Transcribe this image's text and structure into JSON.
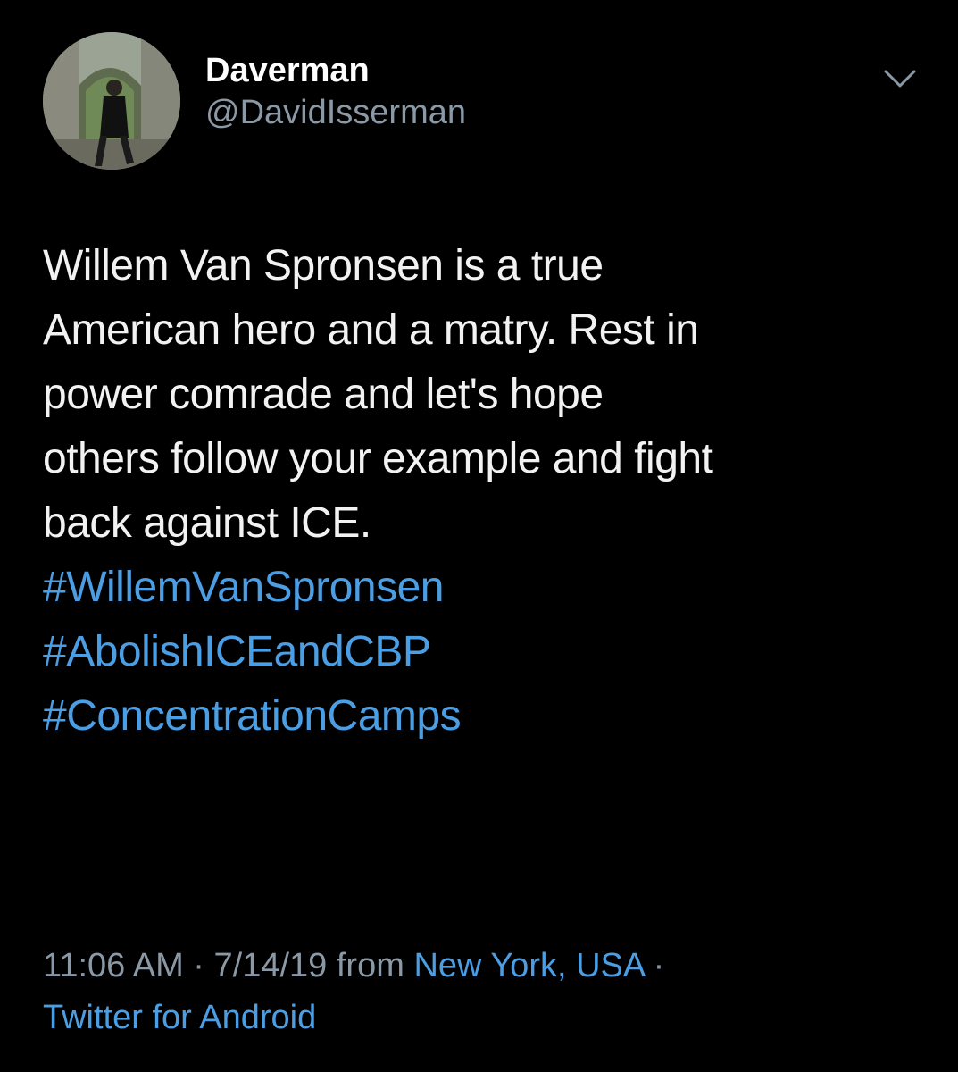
{
  "author": {
    "display_name": "Daverman",
    "handle": "@DavidIsserman"
  },
  "tweet": {
    "text_lines": [
      "Willem Van Spronsen is a true",
      "American hero and a matry. Rest in",
      "power comrade and let's hope",
      "others follow your example and fight",
      "back against ICE."
    ],
    "hashtags": [
      "#WillemVanSpronsen",
      "#AbolishICEandCBP",
      "#ConcentrationCamps"
    ]
  },
  "meta": {
    "time": "11:06 AM",
    "sep1": " · ",
    "date": "7/14/19",
    "from_label": " from ",
    "location": "New York, USA",
    "sep2": " ·",
    "source": "Twitter for Android"
  },
  "icons": {
    "menu": "chevron-down-icon",
    "avatar": "profile-photo"
  },
  "colors": {
    "background": "#000000",
    "text": "#f2f2f2",
    "secondary": "#8b98a5",
    "link": "#4b9ee3"
  }
}
